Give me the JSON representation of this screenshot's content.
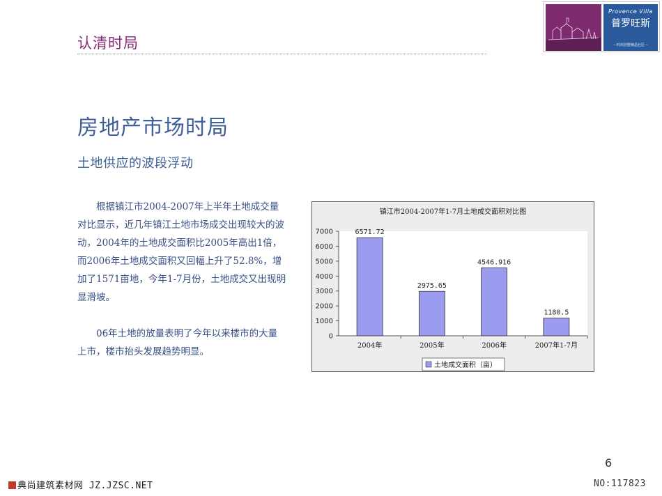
{
  "header": {
    "section_title": "认清时局"
  },
  "logo": {
    "name_en": "Provence Villa",
    "name_cn": "普罗旺斯",
    "tagline": "—时尚别墅精品社区—",
    "colors": {
      "photo": "#7d2a6e",
      "panel": "#2a5a9c"
    }
  },
  "main_title": "房地产市场时局",
  "subtitle": "土地供应的波段浮动",
  "paragraphs": [
    "根据镇江市2004-2007年上半年土地成交量对比显示，近几年镇江土地市场成交出现较大的波动，2004年的土地成交面积比2005年高出1倍，而2006年土地成交面积又回幅上升了52.8%，增加了1571亩地，今年1-7月份，土地成交又出现明显滑坡。",
    "06年土地的放量表明了今年以来楼市的大量上市，楼市抬头发展趋势明显。"
  ],
  "chart_data": {
    "type": "bar",
    "title": "镇江市2004-2007年1-7月土地成交面积对比图",
    "categories": [
      "2004年",
      "2005年",
      "2006年",
      "2007年1-7月"
    ],
    "series": [
      {
        "name": "土地成交面积（亩）",
        "values": [
          6571.72,
          2975.65,
          4546.916,
          1180.5
        ],
        "color": "#9b9bf0"
      }
    ],
    "data_labels": [
      "6571.72",
      "2975.65",
      "4546.916",
      "1180.5"
    ],
    "yticks": [
      "0",
      "1000",
      "2000",
      "3000",
      "4000",
      "5000",
      "6000",
      "7000"
    ],
    "ylim": [
      0,
      7000
    ],
    "legend_position": "bottom",
    "grid": false
  },
  "page_number": "6",
  "footer": {
    "left_text": "典尚建筑素材网 JZ.JZSC.NET",
    "right_text": "NO:117823"
  }
}
